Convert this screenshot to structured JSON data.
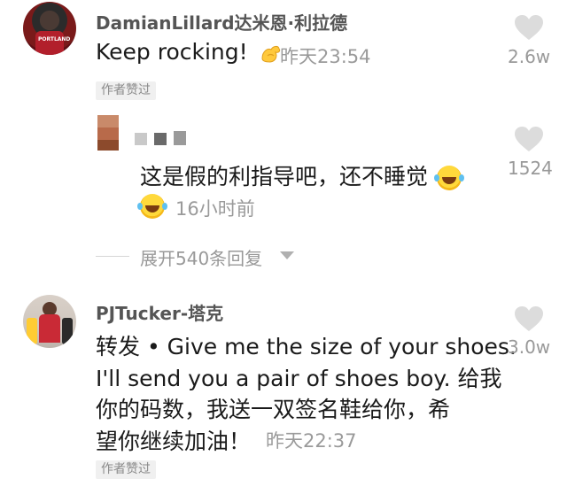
{
  "comments": [
    {
      "username": "DamianLillard达米恩·利拉德",
      "text": "Keep rocking!",
      "emoji": "flexed-biceps",
      "time": "昨天23:54",
      "likes": "2.6w",
      "tag": "作者赞过"
    },
    {
      "username": "PJTucker-塔克",
      "lines": [
        "转发 • Give me the size of your shoes.",
        "I'll send you a pair of shoes boy. 给我",
        "你的码数，我送一双签名鞋给你，希",
        "望你继续加油！"
      ],
      "time": "昨天22:37",
      "likes": "3.0w",
      "tag": "作者赞过"
    }
  ],
  "reply": {
    "text": "这是假的利指导吧，还不睡觉",
    "emoji": "face-with-tears-of-joy",
    "time": "16小时前",
    "likes": "1524"
  },
  "expand_label": "展开540条回复",
  "colors": {
    "username": "#555555",
    "text": "#1a1a1a",
    "muted": "#9a9a9a",
    "heart": "#dcdcdc",
    "tag_bg": "#f0f0f0"
  }
}
